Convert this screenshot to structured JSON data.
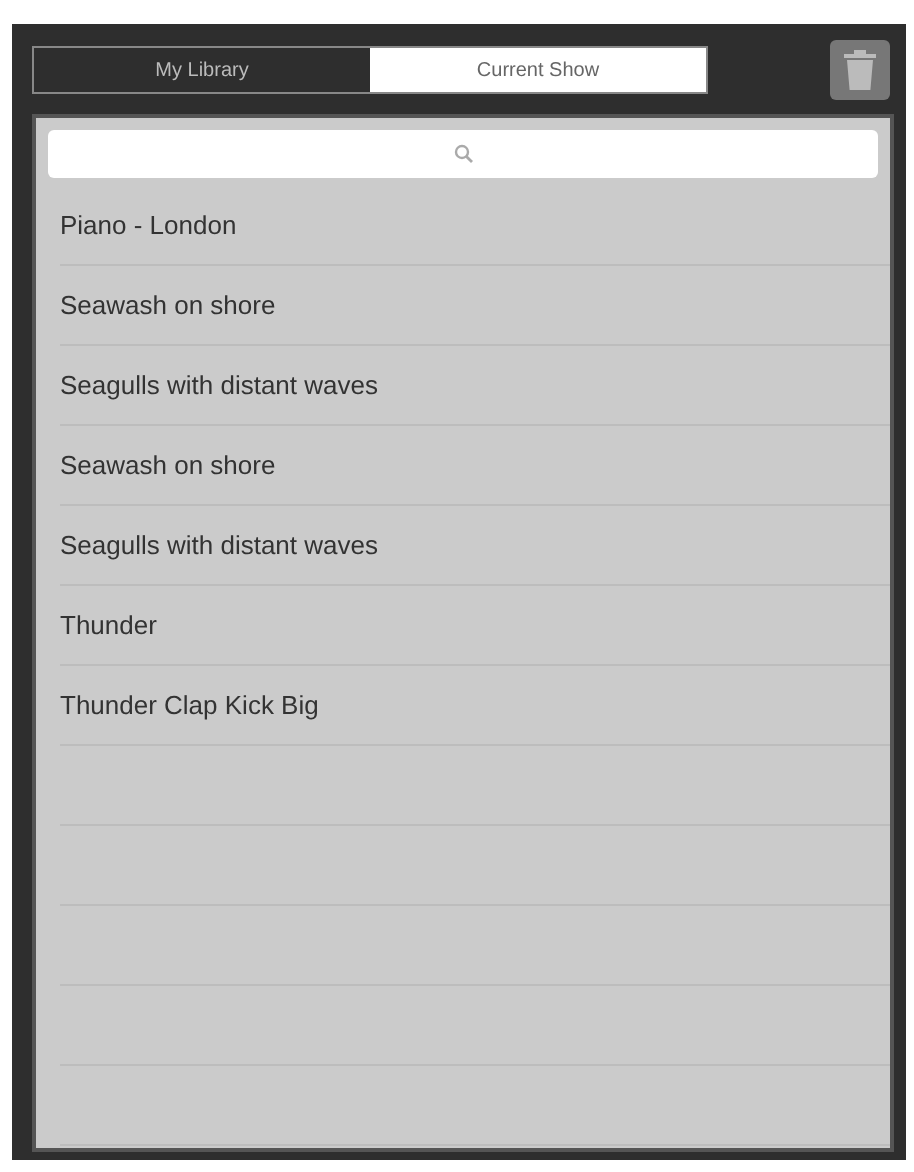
{
  "tabs": [
    {
      "label": "My Library",
      "selected": false
    },
    {
      "label": "Current Show",
      "selected": true
    }
  ],
  "rows": [
    {
      "title": "Piano - London"
    },
    {
      "title": "Seawash on shore"
    },
    {
      "title": "Seagulls with distant waves"
    },
    {
      "title": "Seawash on shore"
    },
    {
      "title": "Seagulls with distant waves"
    },
    {
      "title": "Thunder"
    },
    {
      "title": "Thunder Clap Kick Big"
    }
  ]
}
